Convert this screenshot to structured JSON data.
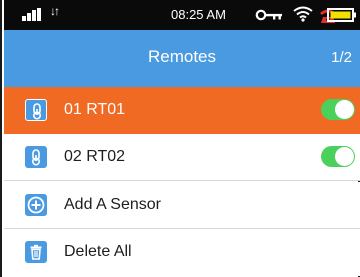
{
  "status_bar": {
    "time": "08:25 AM",
    "icons": [
      "signal-icon",
      "data-arrows-icon",
      "key-icon",
      "wifi-icon",
      "alarm-icon",
      "battery-icon"
    ]
  },
  "header": {
    "title": "Remotes",
    "page_indicator": "1/2"
  },
  "sensors": [
    {
      "label": "01 RT01",
      "icon": "sensor-icon",
      "toggle_on": true,
      "selected": true
    },
    {
      "label": "02 RT02",
      "icon": "sensor-icon",
      "toggle_on": true,
      "selected": false
    }
  ],
  "actions": {
    "add_label": "Add A Sensor",
    "delete_label": "Delete All"
  },
  "colors": {
    "header_blue": "#4a9ae2",
    "selected_orange": "#f06a23",
    "toggle_green": "#4cd05c",
    "status_bar": "#0a0a0a"
  }
}
